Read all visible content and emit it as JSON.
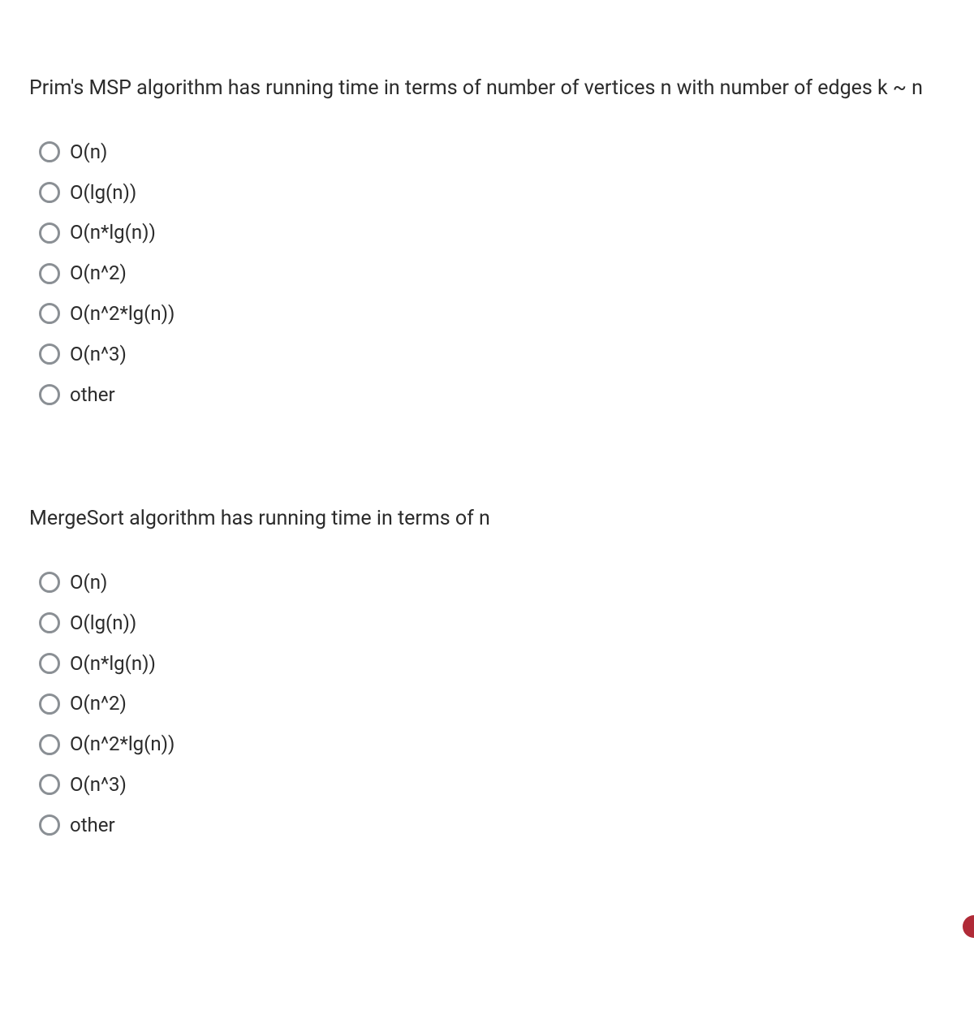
{
  "questions": [
    {
      "prompt": "Prim's MSP algorithm has running time in terms of number of vertices n with number of edges k ~ n",
      "options": [
        "O(n)",
        "O(lg(n))",
        "O(n*lg(n))",
        "O(n^2)",
        "O(n^2*lg(n))",
        "O(n^3)",
        "other"
      ]
    },
    {
      "prompt": "MergeSort algorithm has running time in terms of n",
      "options": [
        "O(n)",
        "O(lg(n))",
        "O(n*lg(n))",
        "O(n^2)",
        "O(n^2*lg(n))",
        "O(n^3)",
        "other"
      ]
    }
  ]
}
